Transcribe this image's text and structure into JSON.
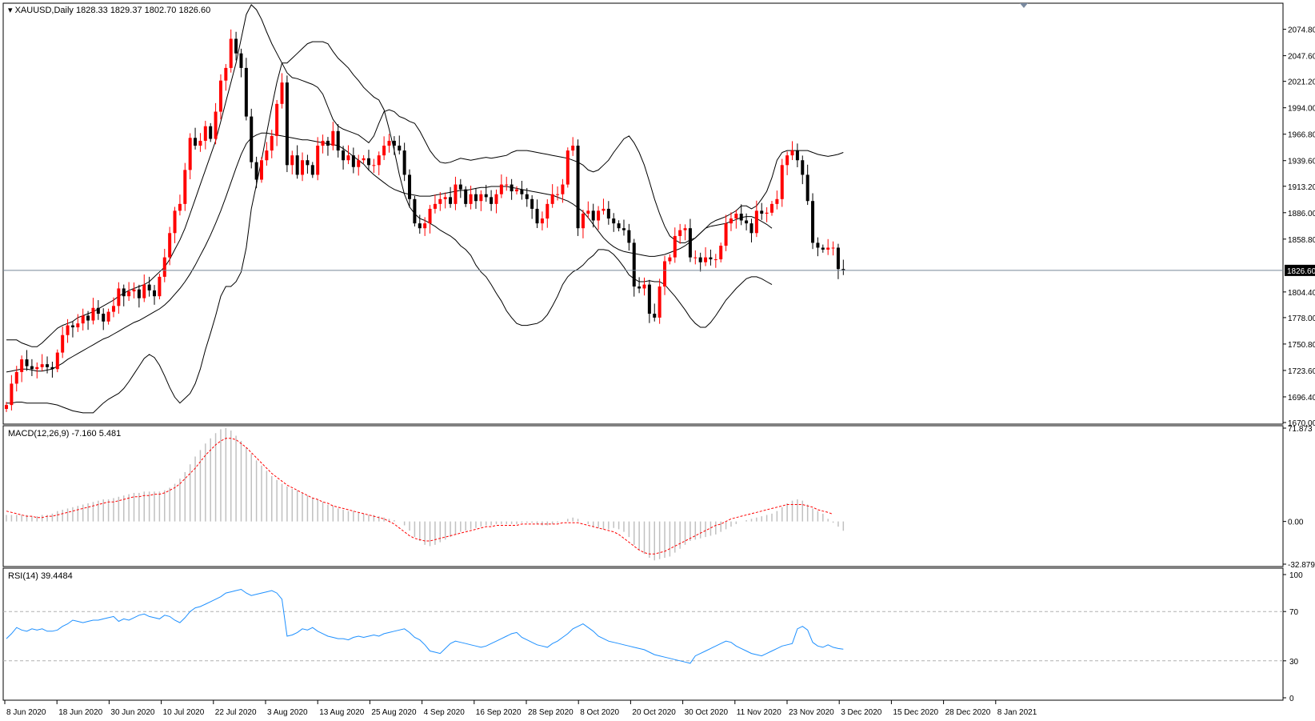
{
  "header": {
    "symbol_label": "XAUUSD,Daily",
    "ohlc_label": "1828.33 1829.37 1802.70 1826.60"
  },
  "macd_panel": {
    "label": "MACD(12,26,9) -7.160 5.481"
  },
  "rsi_panel": {
    "label": "RSI(14) 39.4484"
  },
  "colors": {
    "bull": "#ff0000",
    "bear": "#000000",
    "bollinger": "#000000",
    "macd_histogram": "#c0c0c0",
    "macd_signal": "#ff0000",
    "rsi_line": "#1e90ff",
    "bid_line": "#778899",
    "grid_levels": "#b0b0b0"
  },
  "chart_data": [
    {
      "type": "candlestick",
      "title": "XAUUSD,Daily",
      "indicators": [
        "Bollinger Bands"
      ],
      "current_price": 1826.6,
      "current_price_label": "1826.60",
      "ylim": [
        1670.0,
        2100.0
      ],
      "y_ticks": [
        "2074.80",
        "2047.60",
        "2021.20",
        "1994.00",
        "1966.80",
        "1939.60",
        "1913.20",
        "1886.00",
        "1858.80",
        "1804.40",
        "1778.00",
        "1750.80",
        "1723.60",
        "1696.40",
        "1670.00"
      ],
      "x_tick_labels": [
        "8 Jun 2020",
        "18 Jun 2020",
        "30 Jun 2020",
        "10 Jul 2020",
        "22 Jul 2020",
        "3 Aug 2020",
        "13 Aug 2020",
        "25 Aug 2020",
        "4 Sep 2020",
        "16 Sep 2020",
        "28 Sep 2020",
        "8 Oct 2020",
        "20 Oct 2020",
        "30 Oct 2020",
        "11 Nov 2020",
        "23 Nov 2020",
        "3 Dec 2020",
        "15 Dec 2020",
        "28 Dec 2020",
        "8 Jan 2021"
      ],
      "close": [
        1688,
        1710,
        1722,
        1735,
        1728,
        1725,
        1727,
        1730,
        1727,
        1725,
        1742,
        1760,
        1770,
        1768,
        1772,
        1780,
        1775,
        1788,
        1782,
        1774,
        1784,
        1790,
        1808,
        1800,
        1805,
        1807,
        1798,
        1812,
        1806,
        1800,
        1820,
        1840,
        1865,
        1888,
        1895,
        1930,
        1963,
        1955,
        1960,
        1975,
        1962,
        1990,
        2022,
        2035,
        2065,
        2050,
        2035,
        1985,
        1938,
        1920,
        1940,
        1950,
        1965,
        1998,
        2020,
        1935,
        1945,
        1925,
        1940,
        1935,
        1925,
        1955,
        1960,
        1955,
        1970,
        1950,
        1940,
        1945,
        1933,
        1940,
        1942,
        1935,
        1935,
        1945,
        1955,
        1960,
        1955,
        1950,
        1925,
        1900,
        1875,
        1870,
        1875,
        1890,
        1895,
        1900,
        1902,
        1895,
        1915,
        1910,
        1895,
        1905,
        1898,
        1905,
        1902,
        1895,
        1905,
        1915,
        1915,
        1908,
        1910,
        1905,
        1900,
        1890,
        1875,
        1880,
        1895,
        1905,
        1905,
        1915,
        1950,
        1955,
        1870,
        1885,
        1888,
        1878,
        1888,
        1890,
        1880,
        1875,
        1870,
        1868,
        1855,
        1810,
        1808,
        1812,
        1782,
        1778,
        1810,
        1836,
        1840,
        1862,
        1868,
        1870,
        1840,
        1840,
        1835,
        1840,
        1838,
        1838,
        1852,
        1875,
        1880,
        1885,
        1878,
        1875,
        1865,
        1888,
        1885,
        1886,
        1895,
        1900,
        1935,
        1945,
        1950,
        1940,
        1925,
        1898,
        1855,
        1850,
        1848,
        1850,
        1850,
        1828,
        1826.6
      ],
      "volatility": 8,
      "bollinger": {
        "upper": [
          1755,
          1755,
          1755,
          1752,
          1750,
          1748,
          1748,
          1752,
          1757,
          1762,
          1767,
          1770,
          1772,
          1774,
          1778,
          1780,
          1782,
          1784,
          1787,
          1790,
          1793,
          1796,
          1800,
          1803,
          1806,
          1808,
          1810,
          1812,
          1815,
          1820,
          1825,
          1830,
          1838,
          1848,
          1858,
          1870,
          1885,
          1900,
          1915,
          1930,
          1945,
          1960,
          1980,
          2000,
          2020,
          2040,
          2065,
          2090,
          2100,
          2095,
          2085,
          2072,
          2060,
          2050,
          2040,
          2030,
          2025,
          2024,
          2022,
          2020,
          2018,
          2015,
          2008,
          1995,
          1982,
          1975,
          1972,
          1970,
          1968,
          1966,
          1962,
          1958,
          1965,
          1978,
          1990,
          1992,
          1990,
          1985,
          1983,
          1980,
          1978,
          1970,
          1960,
          1950,
          1943,
          1938,
          1937,
          1938,
          1940,
          1942,
          1941,
          1940,
          1941,
          1942,
          1943,
          1942,
          1943,
          1944,
          1945,
          1948,
          1950,
          1950,
          1950,
          1949,
          1948,
          1947,
          1946,
          1945,
          1944,
          1943,
          1942,
          1940,
          1938,
          1935,
          1930,
          1928,
          1930,
          1935,
          1940,
          1948,
          1955,
          1962,
          1965,
          1958,
          1948,
          1935,
          1918,
          1900,
          1885,
          1872,
          1862,
          1858,
          1855,
          1855,
          1858,
          1860,
          1865,
          1870,
          1875,
          1878,
          1880,
          1882,
          1885,
          1888,
          1893,
          1893,
          1890,
          1893,
          1900,
          1908,
          1922,
          1940,
          1948,
          1950,
          1950,
          1950,
          1950,
          1950,
          1948,
          1946,
          1945,
          1944,
          1945,
          1946,
          1948
        ],
        "middle": [
          1722,
          1723,
          1724,
          1725,
          1725,
          1724,
          1723,
          1723,
          1724,
          1725,
          1728,
          1731,
          1735,
          1738,
          1741,
          1744,
          1747,
          1750,
          1753,
          1756,
          1758,
          1761,
          1764,
          1767,
          1770,
          1773,
          1775,
          1778,
          1781,
          1784,
          1787,
          1791,
          1796,
          1802,
          1808,
          1815,
          1823,
          1832,
          1842,
          1852,
          1863,
          1875,
          1888,
          1902,
          1917,
          1932,
          1946,
          1957,
          1963,
          1966,
          1968,
          1968,
          1967,
          1966,
          1965,
          1964,
          1963,
          1962,
          1961,
          1961,
          1960,
          1959,
          1958,
          1957,
          1956,
          1955,
          1952,
          1948,
          1944,
          1940,
          1936,
          1930,
          1925,
          1921,
          1917,
          1913,
          1910,
          1908,
          1906,
          1905,
          1904,
          1903,
          1903,
          1903,
          1904,
          1905,
          1906,
          1907,
          1908,
          1909,
          1909,
          1910,
          1911,
          1912,
          1912,
          1913,
          1913,
          1913,
          1913,
          1912,
          1911,
          1910,
          1909,
          1908,
          1907,
          1906,
          1905,
          1904,
          1902,
          1900,
          1898,
          1895,
          1891,
          1887,
          1881,
          1874,
          1867,
          1860,
          1855,
          1851,
          1848,
          1846,
          1845,
          1844,
          1843,
          1842,
          1841,
          1841,
          1842,
          1843,
          1845,
          1847,
          1849,
          1852,
          1856,
          1860,
          1865,
          1870,
          1872,
          1873,
          1874,
          1875,
          1877,
          1879,
          1881,
          1882,
          1882,
          1880,
          1877,
          1874,
          1870
        ],
        "lower": [
          1690,
          1690,
          1691,
          1691,
          1690,
          1690,
          1690,
          1690,
          1690,
          1689,
          1688,
          1686,
          1684,
          1682,
          1681,
          1680,
          1680,
          1680,
          1685,
          1690,
          1694,
          1697,
          1700,
          1705,
          1712,
          1720,
          1728,
          1736,
          1740,
          1737,
          1729,
          1718,
          1706,
          1696,
          1690,
          1695,
          1700,
          1710,
          1725,
          1745,
          1762,
          1780,
          1800,
          1810,
          1810,
          1815,
          1825,
          1850,
          1890,
          1915,
          1940,
          1968,
          1995,
          2020,
          2040,
          2040,
          2045,
          2050,
          2055,
          2060,
          2062,
          2062,
          2062,
          2060,
          2052,
          2045,
          2040,
          2035,
          2028,
          2022,
          2015,
          2010,
          2005,
          2002,
          1992,
          1972,
          1950,
          1925,
          1905,
          1892,
          1885,
          1880,
          1878,
          1875,
          1872,
          1868,
          1865,
          1862,
          1858,
          1852,
          1848,
          1842,
          1832,
          1825,
          1820,
          1812,
          1803,
          1795,
          1785,
          1778,
          1772,
          1770,
          1770,
          1771,
          1772,
          1775,
          1781,
          1790,
          1800,
          1812,
          1820,
          1825,
          1828,
          1832,
          1838,
          1842,
          1848,
          1848,
          1847,
          1843,
          1837,
          1830,
          1822,
          1818,
          1815,
          1815,
          1816,
          1815,
          1815,
          1812,
          1806,
          1800,
          1793,
          1786,
          1778,
          1772,
          1768,
          1768,
          1773,
          1780,
          1788,
          1796,
          1802,
          1808,
          1813,
          1818,
          1820,
          1820,
          1818,
          1815,
          1812
        ]
      }
    },
    {
      "type": "bar+line",
      "title": "MACD(12,26,9)",
      "macd_value": -7.16,
      "signal_value": 5.481,
      "ylim": [
        -32.879,
        71.873
      ],
      "y_ticks": [
        "71.873",
        "0.00",
        "-32.879"
      ],
      "histogram": [
        5,
        5,
        5,
        5,
        5,
        4,
        4,
        5,
        5,
        6,
        8,
        9,
        10,
        11,
        12,
        13,
        14,
        15,
        16,
        17,
        17,
        18,
        19,
        20,
        21,
        22,
        22,
        23,
        23,
        23,
        23,
        24,
        26,
        29,
        33,
        38,
        44,
        50,
        55,
        60,
        64,
        68,
        71,
        72,
        70,
        66,
        62,
        57,
        52,
        47,
        43,
        39,
        35,
        32,
        29,
        27,
        25,
        24,
        22,
        20,
        18,
        17,
        15,
        13,
        12,
        10,
        9,
        8,
        8,
        7,
        6,
        5,
        5,
        4,
        3,
        2,
        1,
        0,
        -3,
        -7,
        -12,
        -15,
        -18,
        -19,
        -18,
        -16,
        -14,
        -12,
        -10,
        -8,
        -7,
        -6,
        -5,
        -4,
        -3,
        -3,
        -2,
        -2,
        -2,
        -2,
        -2,
        -1,
        -1,
        -1,
        -2,
        -3,
        -3,
        -2,
        -1,
        0,
        2,
        3,
        2,
        0,
        -2,
        -4,
        -5,
        -6,
        -6,
        -5,
        -6,
        -8,
        -12,
        -18,
        -22,
        -25,
        -28,
        -30,
        -29,
        -28,
        -27,
        -24,
        -21,
        -18,
        -15,
        -14,
        -13,
        -12,
        -11,
        -10,
        -8,
        -6,
        -4,
        -2,
        0,
        1,
        2,
        3,
        4,
        5,
        6,
        8,
        11,
        14,
        16,
        17,
        16,
        13,
        10,
        8,
        6,
        2,
        -1,
        -4,
        -7.16
      ],
      "signal": [
        8,
        7,
        6,
        5,
        4,
        4,
        3,
        3,
        4,
        4,
        5,
        6,
        7,
        8,
        9,
        10,
        11,
        12,
        13,
        14,
        15,
        15,
        16,
        17,
        18,
        19,
        19,
        20,
        20,
        21,
        21,
        22,
        24,
        26,
        29,
        33,
        37,
        41,
        46,
        51,
        55,
        59,
        62,
        64,
        64,
        63,
        60,
        57,
        53,
        49,
        45,
        41,
        37,
        34,
        31,
        28,
        26,
        24,
        22,
        20,
        18,
        17,
        15,
        14,
        12,
        11,
        10,
        9,
        8,
        7,
        6,
        5,
        4,
        3,
        2,
        0,
        -2,
        -5,
        -8,
        -11,
        -13,
        -14,
        -15,
        -15,
        -14,
        -13,
        -12,
        -11,
        -10,
        -9,
        -8,
        -7,
        -6,
        -5,
        -4,
        -4,
        -3,
        -3,
        -3,
        -3,
        -3,
        -2,
        -2,
        -2,
        -2,
        -2,
        -2,
        -2,
        -2,
        -1,
        -1,
        -1,
        -1,
        -2,
        -3,
        -4,
        -5,
        -6,
        -7,
        -8,
        -10,
        -13,
        -16,
        -19,
        -22,
        -24,
        -25,
        -25,
        -24,
        -23,
        -21,
        -19,
        -17,
        -15,
        -13,
        -11,
        -9,
        -7,
        -5,
        -3,
        -2,
        0,
        2,
        3,
        4,
        5,
        6,
        7,
        8,
        9,
        10,
        11,
        12,
        13,
        13,
        13,
        13,
        12,
        11,
        9,
        8,
        7,
        5.481
      ]
    },
    {
      "type": "line",
      "title": "RSI(14)",
      "current_value": 39.4484,
      "ylim": [
        0,
        100
      ],
      "y_ticks": [
        "100",
        "70",
        "30",
        "0"
      ],
      "levels": [
        70,
        30
      ],
      "values": [
        48,
        52,
        57,
        55,
        54,
        56,
        55,
        56,
        54,
        54,
        55,
        58,
        60,
        63,
        62,
        61,
        62,
        63,
        63,
        64,
        65,
        66,
        62,
        64,
        63,
        65,
        67,
        68,
        66,
        65,
        64,
        67,
        66,
        63,
        61,
        65,
        70,
        73,
        74,
        76,
        78,
        80,
        82,
        85,
        86,
        87,
        88,
        85,
        83,
        84,
        85,
        86,
        87,
        85,
        80,
        50,
        51,
        53,
        56,
        55,
        57,
        54,
        52,
        50,
        49,
        48,
        48,
        47,
        49,
        50,
        49,
        50,
        51,
        50,
        52,
        53,
        54,
        55,
        56,
        53,
        49,
        47,
        43,
        38,
        37,
        36,
        40,
        44,
        46,
        45,
        44,
        43,
        42,
        41,
        42,
        44,
        46,
        48,
        50,
        52,
        53,
        49,
        47,
        45,
        43,
        42,
        41,
        44,
        46,
        49,
        52,
        56,
        58,
        60,
        57,
        54,
        50,
        48,
        46,
        45,
        44,
        43,
        42,
        41,
        40,
        39,
        37,
        35,
        34,
        33,
        32,
        31,
        30,
        29,
        28,
        34,
        36,
        38,
        40,
        42,
        44,
        46,
        45,
        42,
        40,
        38,
        36,
        35,
        34,
        36,
        38,
        40,
        42,
        43,
        44,
        56,
        58,
        55,
        45,
        42,
        41,
        43,
        41,
        40,
        39.5
      ]
    }
  ]
}
